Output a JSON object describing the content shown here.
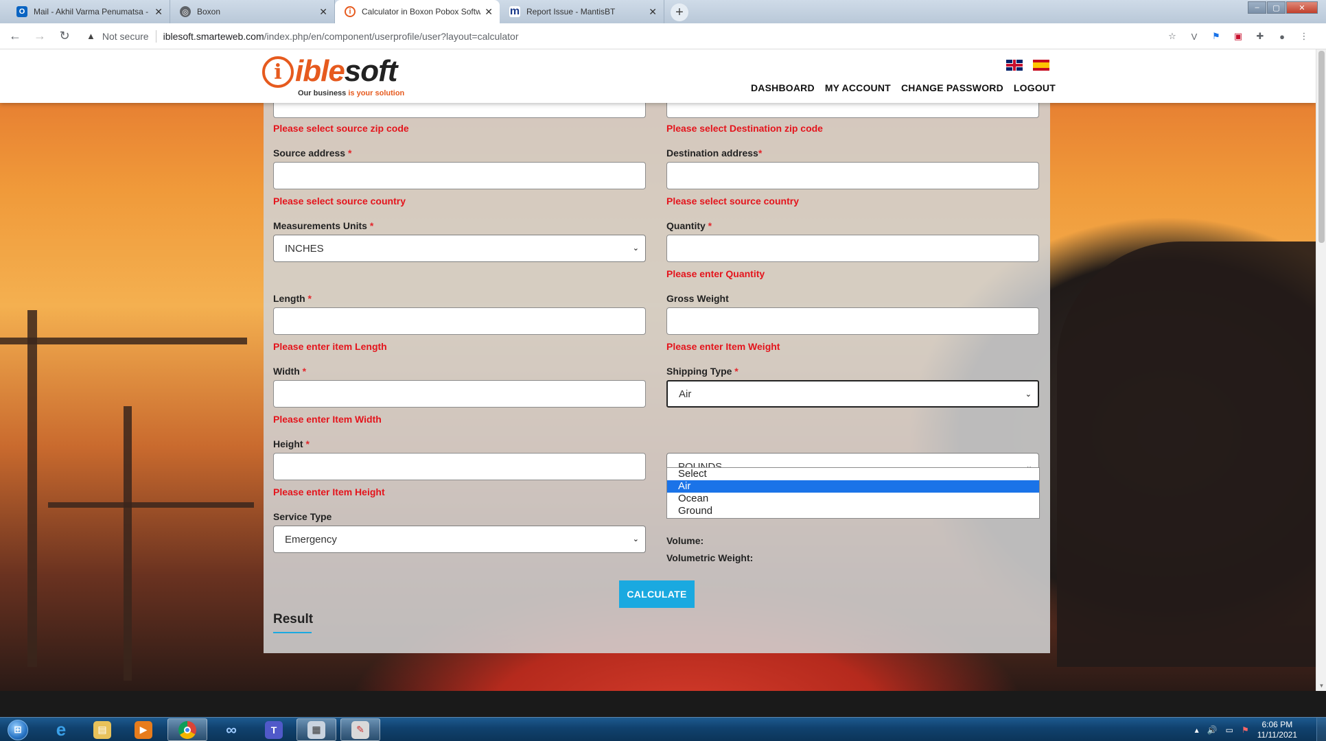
{
  "browser": {
    "tabs": [
      {
        "title": "Mail - Akhil Varma Penumatsa - O",
        "icon": "outlook-icon",
        "active": false
      },
      {
        "title": "Boxon",
        "icon": "globe-icon",
        "active": false
      },
      {
        "title": "Calculator in Boxon Pobox Softw",
        "icon": "iblesoft-icon",
        "active": true
      },
      {
        "title": "Report Issue - MantisBT",
        "icon": "mantis-icon",
        "active": false
      }
    ],
    "security_label": "Not secure",
    "url_host": "iblesoft.smarteweb.com",
    "url_path": "/index.php/en/component/userprofile/user?layout=calculator"
  },
  "site": {
    "logo_text_main": "ible",
    "logo_text_soft": "soft",
    "logo_tagline_a": "Our business ",
    "logo_tagline_b": "is your solution",
    "nav": [
      "DASHBOARD",
      "MY ACCOUNT",
      "CHANGE PASSWORD",
      "LOGOUT"
    ]
  },
  "form": {
    "source_zip_error": "Please select source zip code",
    "dest_zip_error": "Please select Destination zip code",
    "source_address_label": "Source address",
    "source_address_error": "Please select source country",
    "dest_address_label": "Destination address",
    "dest_address_error": "Please select source country",
    "units_label": "Measurements Units",
    "units_value": "INCHES",
    "quantity_label": "Quantity",
    "quantity_error": "Please enter Quantity",
    "length_label": "Length",
    "length_error": "Please enter item Length",
    "gross_weight_label": "Gross Weight",
    "gross_weight_error": "Please enter Item Weight",
    "width_label": "Width",
    "width_error": "Please enter Item Width",
    "shipping_type_label": "Shipping Type",
    "shipping_type_value": "Air",
    "shipping_options": [
      "Select",
      "Air",
      "Ocean",
      "Ground"
    ],
    "height_label": "Height",
    "height_error": "Please enter Item Height",
    "weight_unit_value": "POUNDS",
    "service_type_label": "Service Type",
    "service_type_value": "Emergency",
    "volume_label": "Volume:",
    "volumetric_label": "Volumetric Weight:",
    "calculate_label": "CALCULATE",
    "result_heading": "Result",
    "required_mark": "*"
  },
  "taskbar": {
    "time": "6:06 PM",
    "date": "11/11/2021",
    "apps": [
      "ie-icon",
      "explorer-icon",
      "media-player-icon",
      "chrome-icon",
      "app-icon",
      "teams-icon",
      "calculator-icon",
      "paint-icon"
    ]
  },
  "colors": {
    "brand": "#e65a1e",
    "error": "#e4141c",
    "button": "#1aa9e0",
    "dropdown_highlight": "#1a73e8"
  }
}
